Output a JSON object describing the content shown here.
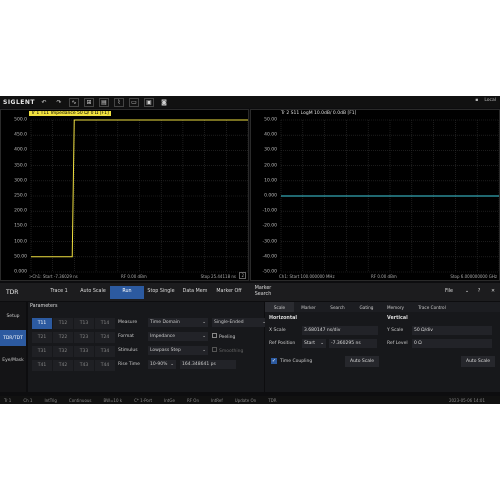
{
  "topbar": {
    "logo": "SIGLENT",
    "icons": [
      "undo-icon",
      "redo-icon",
      "marker-icon",
      "measure-icon",
      "calibrate-icon",
      "trace-icon",
      "display-icon",
      "setup-icon",
      "screenshot-icon"
    ],
    "remote_label": "Local"
  },
  "left_plot": {
    "label": "Tr 1  T11 Impedance 50 Ω/ 0 Ω [F1]",
    "label_color": "#f0e040",
    "y_ticks": [
      "500.0",
      "450.0",
      "400.0",
      "350.0",
      "300.0",
      "250.0",
      "200.0",
      "150.0",
      "100.0",
      "50.00",
      "0.000"
    ],
    "footer_start": ">Ch1: Start -7.36029 ns",
    "footer_center": "RF 0.00 dBm",
    "footer_stop": "Stop 25.44118 ns",
    "footer_marker": "2"
  },
  "right_plot": {
    "label": "Tr 2  S11 LogM 10.0dB/ 0.0dB [F1]",
    "label_color": "#40d0e0",
    "y_ticks": [
      "50.00",
      "40.00",
      "30.00",
      "20.00",
      "10.00",
      "0.000",
      "-10.00",
      "-20.00",
      "-30.00",
      "-40.00",
      "-50.00"
    ],
    "footer_start": "Ch1: Start 100.000000 MHz",
    "footer_center": "RF 0.00 dBm",
    "footer_stop": "Stop 6.000000000 GHz"
  },
  "menu": {
    "title": "TDR",
    "items": [
      "Trace 1",
      "Auto Scale",
      "Run",
      "Stop Single",
      "Data Mem",
      "Marker Off",
      "Marker Search"
    ],
    "file": "File",
    "icons": [
      "help-icon",
      "close-icon"
    ]
  },
  "side": [
    "Setup",
    "TDR/TDT",
    "Eye/Mask"
  ],
  "params": {
    "title": "Parameters",
    "grid": [
      "T11",
      "T12",
      "T13",
      "T14",
      "T21",
      "T22",
      "T23",
      "T24",
      "T31",
      "T32",
      "T33",
      "T34",
      "T41",
      "T42",
      "T43",
      "T44"
    ],
    "measure_label": "Measure",
    "measure_value": "Time Domain",
    "mode_value": "Single-Ended",
    "format_label": "Format",
    "format_value": "Impedance",
    "peeling_label": "Peeling",
    "stimulus_label": "Stimulus",
    "stimulus_value": "Lowpass Step",
    "smoothing_label": "Smoothing",
    "rise_label": "Rise Time",
    "rise_pct": "10-90%",
    "rise_value": "164.348641 ps"
  },
  "right_panel": {
    "tabs": [
      "Scale",
      "Marker",
      "Search",
      "Gating",
      "Memory",
      "Trace Control"
    ],
    "horizontal": "Horizontal",
    "xscale_label": "X Scale",
    "xscale_value": "3.680147 ns/div",
    "refpos_label": "Ref Position",
    "refpos_sel": "Start",
    "refpos_value": "-7.360295 ns",
    "vertical": "Vertical",
    "yscale_label": "Y Scale",
    "yscale_value": "50 Ω/div",
    "reflevel_label": "Ref Level",
    "reflevel_value": "0 Ω",
    "time_coupling": "Time Coupling",
    "auto_scale_1": "Auto Scale",
    "auto_scale_2": "Auto Scale"
  },
  "status": {
    "items": [
      "Tr 1",
      "Ch 1",
      "IntTrig",
      "Continuous",
      "BW=10 k",
      "C* 1-Port",
      "IntGe",
      "RF On",
      "IntRef",
      "Update On",
      "TDR"
    ],
    "datetime": "2023-05-06 14:01"
  }
}
